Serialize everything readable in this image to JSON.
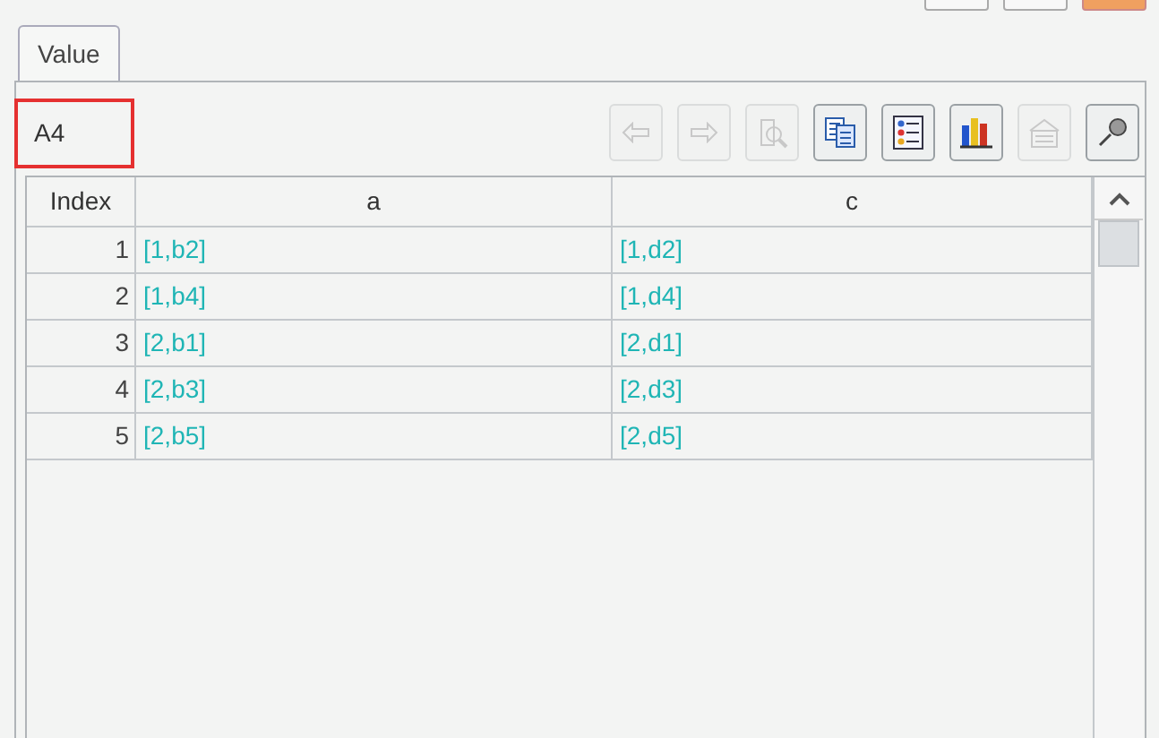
{
  "tabs": [
    {
      "label": "Value",
      "selected": true
    }
  ],
  "cell_name": "A4",
  "toolbar": [
    {
      "kind": "back",
      "disabled": true
    },
    {
      "kind": "forward",
      "disabled": true
    },
    {
      "kind": "zoom",
      "disabled": true
    },
    {
      "kind": "copy",
      "disabled": false
    },
    {
      "kind": "list",
      "disabled": false
    },
    {
      "kind": "chart",
      "disabled": false
    },
    {
      "kind": "properties",
      "disabled": true
    },
    {
      "kind": "pin",
      "disabled": false
    }
  ],
  "table": {
    "columns": [
      "Index",
      "a",
      "c"
    ],
    "rows": [
      [
        "1",
        "[1,b2]",
        "[1,d2]"
      ],
      [
        "2",
        "[1,b4]",
        "[1,d4]"
      ],
      [
        "3",
        "[2,b1]",
        "[2,d1]"
      ],
      [
        "4",
        "[2,b3]",
        "[2,d3]"
      ],
      [
        "5",
        "[2,b5]",
        "[2,d5]"
      ]
    ]
  }
}
